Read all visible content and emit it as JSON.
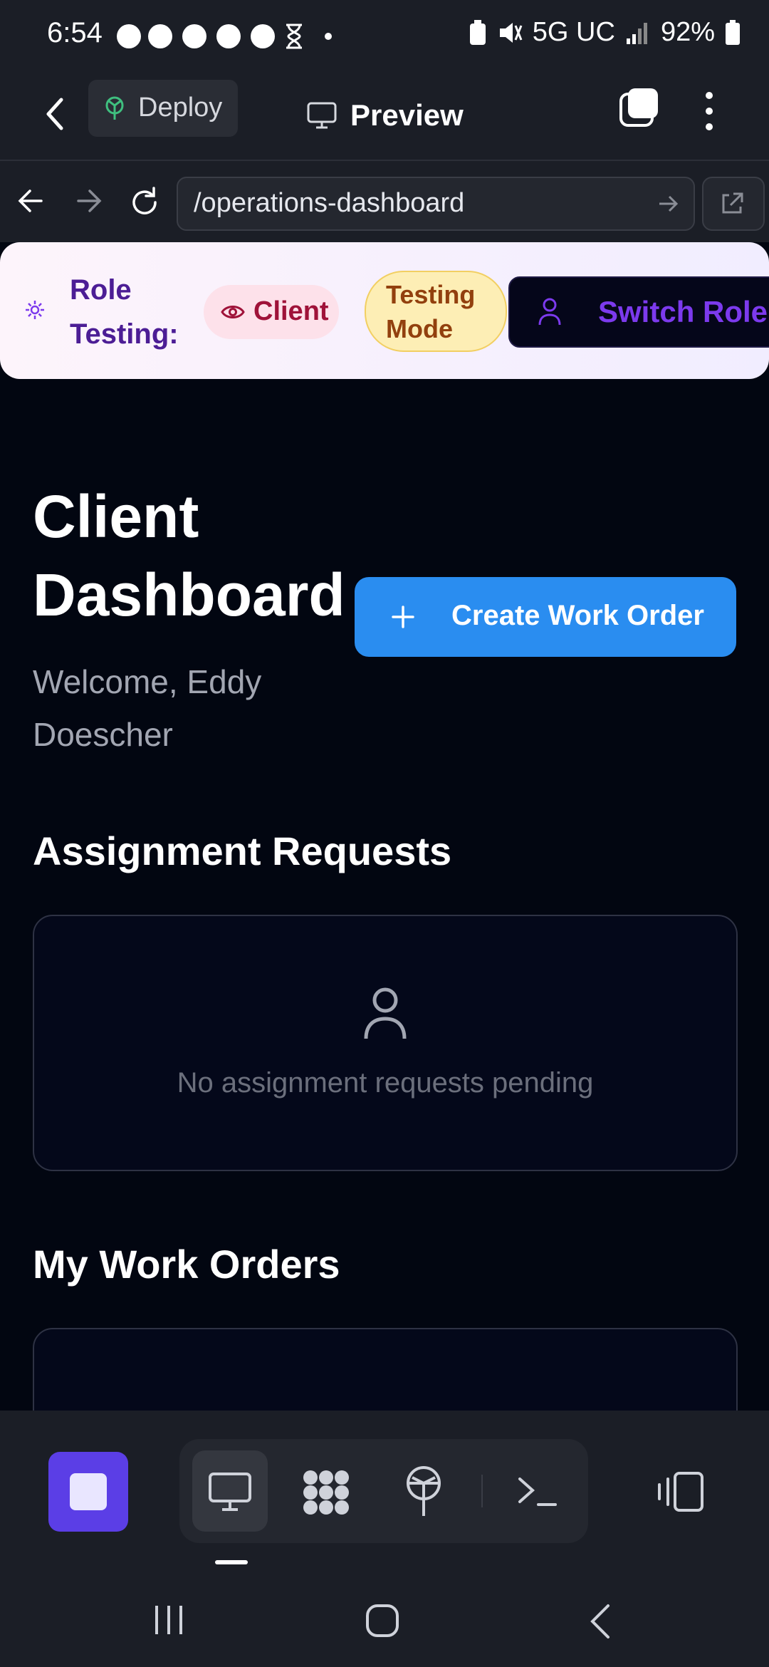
{
  "status_bar": {
    "time": "6:54",
    "network": "5G UC",
    "battery": "92%"
  },
  "header": {
    "deploy_label": "Deploy",
    "preview_label": "Preview"
  },
  "browser": {
    "url": "/operations-dashboard"
  },
  "role_banner": {
    "label_line1": "Role",
    "label_line2": "Testing:",
    "role_pill": "Client",
    "mode_line1": "Testing",
    "mode_line2": "Mode",
    "switch_label": "Switch Role"
  },
  "dashboard": {
    "title_line1": "Client",
    "title_line2": "Dashboard",
    "welcome_line1": "Welcome, Eddy",
    "welcome_line2": "Doescher",
    "create_button": "Create Work Order",
    "assignments_title": "Assignment Requests",
    "assignments_empty": "No assignment requests pending",
    "work_orders_title": "My Work Orders"
  },
  "colors": {
    "background": "#020611",
    "primary_button": "#2a8df0",
    "stop_button": "#5b3ee6",
    "role_accent": "#4c1d95",
    "switch_role_text": "#7c3aed",
    "client_pill_text": "#9f1239",
    "testing_pill_text": "#92400e"
  },
  "icons": [
    "back-arrow-icon",
    "deploy-icon",
    "monitor-icon",
    "tabs-icon",
    "more-vert-icon",
    "nav-back-icon",
    "nav-forward-icon",
    "reload-icon",
    "go-arrow-icon",
    "external-link-icon",
    "gear-icon",
    "eye-icon",
    "user-icon",
    "plus-icon",
    "stop-icon",
    "grid-icon",
    "deploy-tab-icon",
    "terminal-icon",
    "devices-icon",
    "recents-icon",
    "home-icon",
    "system-back-icon"
  ]
}
